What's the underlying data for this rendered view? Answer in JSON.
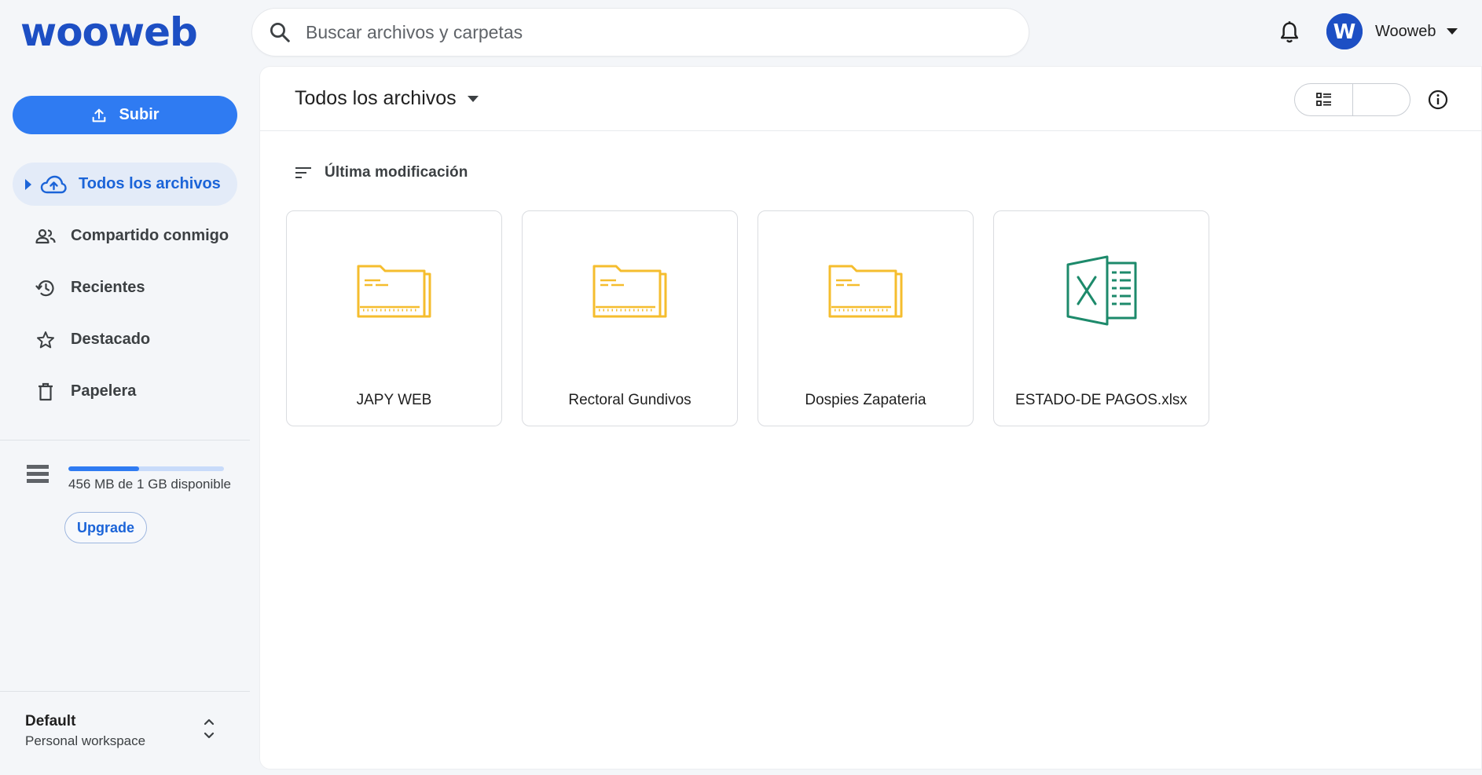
{
  "brand": {
    "logo_text": "wooweb",
    "color": "#1d4fc4"
  },
  "search": {
    "placeholder": "Buscar archivos y carpetas",
    "value": ""
  },
  "user": {
    "name": "Wooweb",
    "avatar_letter": "W"
  },
  "sidebar": {
    "upload_label": "Subir",
    "items": [
      {
        "label": "Todos los archivos",
        "icon": "cloud-upload-icon",
        "active": true
      },
      {
        "label": "Compartido conmigo",
        "icon": "people-icon",
        "active": false
      },
      {
        "label": "Recientes",
        "icon": "history-icon",
        "active": false
      },
      {
        "label": "Destacado",
        "icon": "star-icon",
        "active": false
      },
      {
        "label": "Papelera",
        "icon": "trash-icon",
        "active": false
      }
    ],
    "storage": {
      "text": "456 MB de 1 GB disponible",
      "used_fraction": 0.456
    },
    "upgrade_label": "Upgrade",
    "workspace": {
      "name": "Default",
      "type": "Personal workspace"
    }
  },
  "main": {
    "title": "Todos los archivos",
    "sort_label": "Última modificación",
    "view_mode": "grid",
    "items": [
      {
        "name": "JAPY WEB",
        "type": "folder"
      },
      {
        "name": "Rectoral Gundivos",
        "type": "folder"
      },
      {
        "name": "Dospies Zapateria",
        "type": "folder"
      },
      {
        "name": "ESTADO-DE PAGOS.xlsx",
        "type": "excel"
      }
    ]
  },
  "colors": {
    "accent": "#2f7bf2",
    "folder": "#f5bd2e",
    "excel": "#1d8a6b",
    "active_bg": "#e3ebf8"
  }
}
